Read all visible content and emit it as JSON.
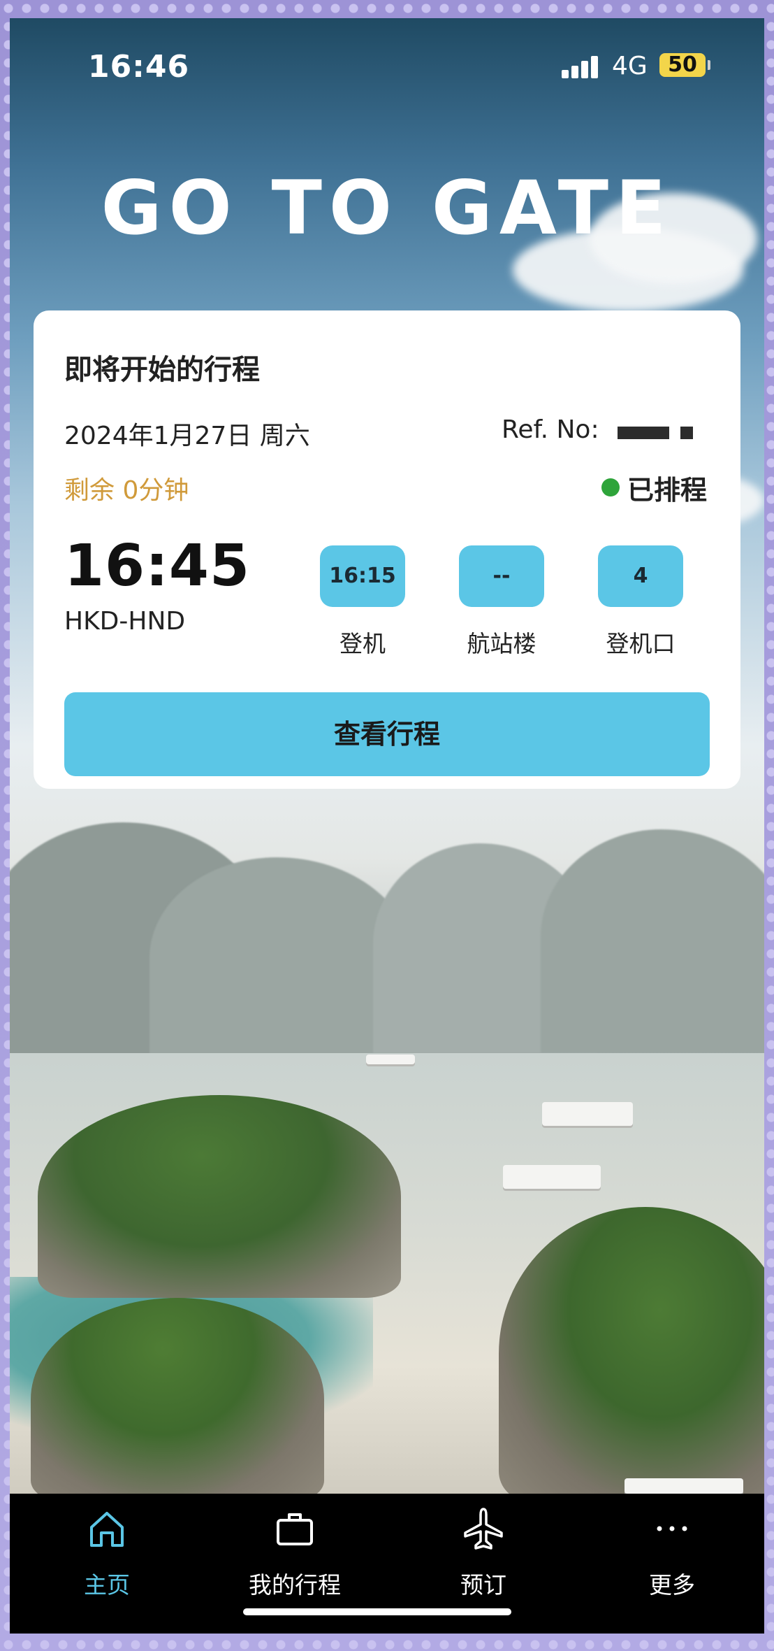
{
  "status_bar": {
    "time": "16:46",
    "network": "4G",
    "battery": "50"
  },
  "brand": {
    "logo_text": "GO TO GATE"
  },
  "trip_card": {
    "title": "即将开始的行程",
    "date": "2024年1月27日 周六",
    "ref_label": "Ref. No:",
    "remaining": "剩余 0分钟",
    "status": "已排程",
    "departure_time": "16:45",
    "route": "HKD-HND",
    "details": [
      {
        "value": "16:15",
        "label": "登机"
      },
      {
        "value": "--",
        "label": "航站楼"
      },
      {
        "value": "4",
        "label": "登机口"
      }
    ],
    "view_button": "查看行程"
  },
  "tabbar": {
    "items": [
      {
        "label": "主页",
        "icon": "home-icon",
        "active": true
      },
      {
        "label": "我的行程",
        "icon": "briefcase-icon",
        "active": false
      },
      {
        "label": "预订",
        "icon": "airplane-icon",
        "active": false
      },
      {
        "label": "更多",
        "icon": "more-icon",
        "active": false
      }
    ]
  },
  "colors": {
    "accent": "#5bc6e6",
    "remaining": "#d09a3a",
    "status_ok": "#2ea43a",
    "battery": "#f3d54a"
  }
}
